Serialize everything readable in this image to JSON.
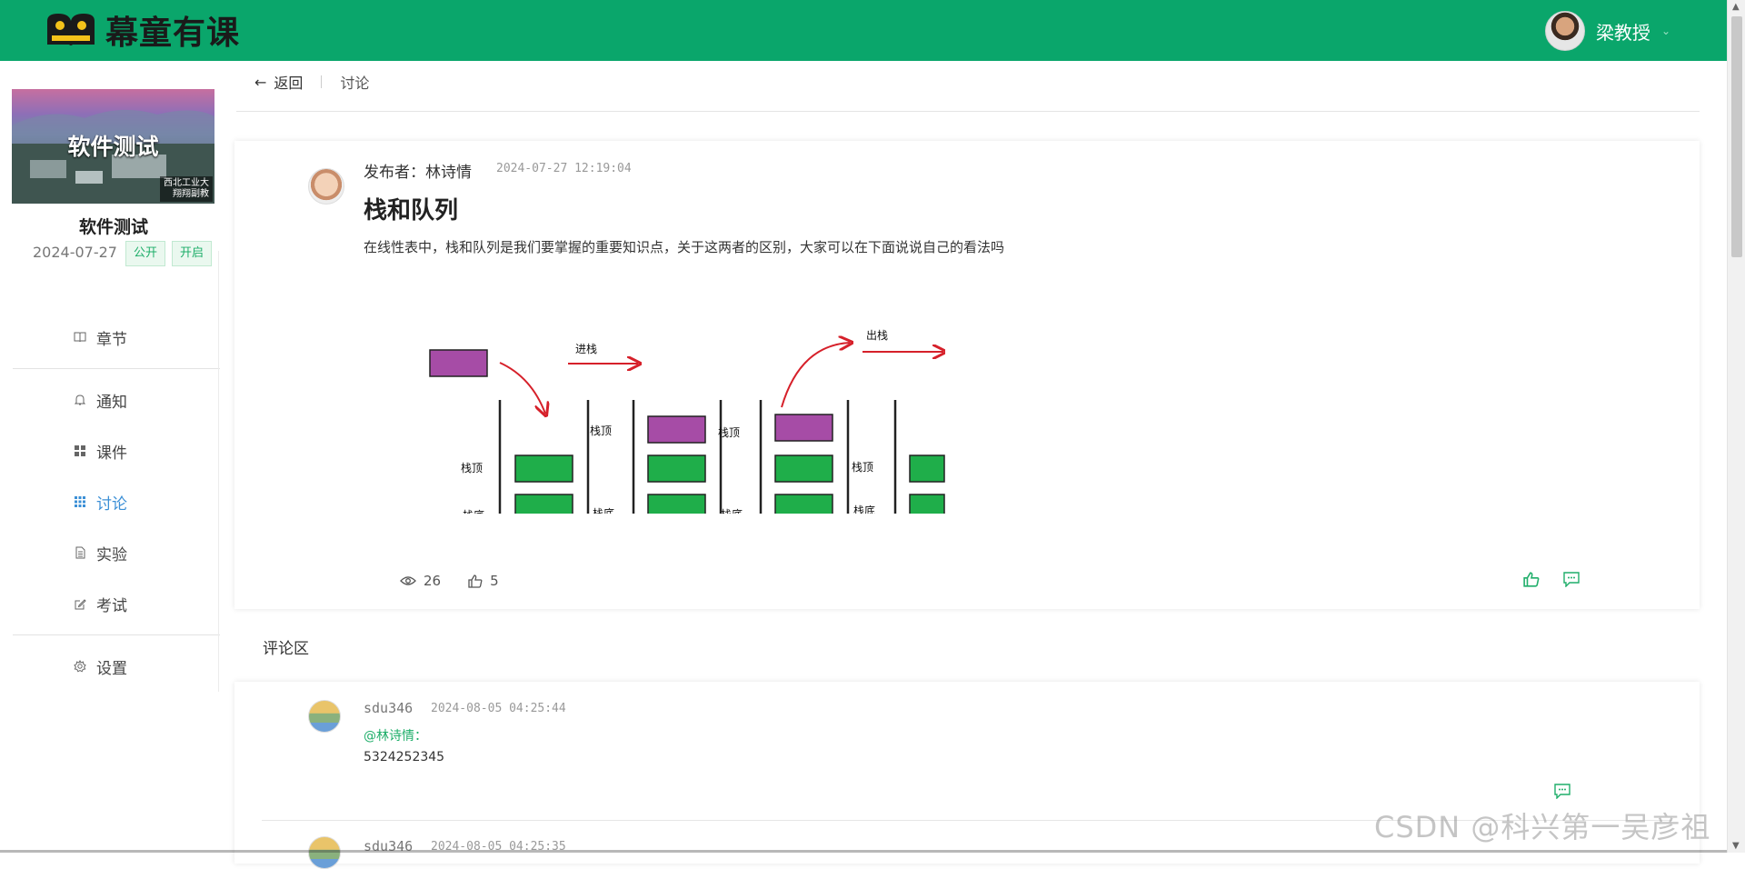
{
  "app": {
    "logo_text": "幕童有课"
  },
  "user": {
    "name": "梁教授"
  },
  "course": {
    "cover_title": "软件测试",
    "cover_badge_line1": "西北工业大",
    "cover_badge_line2": "翔翔副教",
    "name": "软件测试",
    "date": "2024-07-27",
    "tag_public": "公开",
    "tag_open": "开启"
  },
  "sidebar": {
    "items": [
      {
        "label": "章节",
        "icon": "book-icon"
      },
      {
        "label": "通知",
        "icon": "bell-icon"
      },
      {
        "label": "课件",
        "icon": "grid-icon"
      },
      {
        "label": "讨论",
        "icon": "table-icon",
        "active": true
      },
      {
        "label": "实验",
        "icon": "document-icon"
      },
      {
        "label": "考试",
        "icon": "edit-icon"
      },
      {
        "label": "设置",
        "icon": "gear-icon"
      }
    ]
  },
  "breadcrumb": {
    "back": "返回",
    "current": "讨论"
  },
  "post": {
    "author": "发布者：林诗情",
    "time": "2024-07-27 12:19:04",
    "title": "栈和队列",
    "body": "在线性表中，栈和队列是我们要掌握的重要知识点，关于这两者的区别，大家可以在下面说说自己的看法吗",
    "views": "26",
    "likes": "5",
    "figure": {
      "label_push": "进栈",
      "label_pop": "出栈",
      "label_top": "栈顶",
      "label_bottom": "栈底",
      "color_box_purple": "#a64ca6",
      "color_box_green": "#1fae4a",
      "color_arrow": "#d6202a"
    }
  },
  "comments": {
    "title": "评论区",
    "items": [
      {
        "user": "sdu346",
        "time": "2024-08-05 04:25:44",
        "mention": "@林诗情：",
        "text": "5324252345"
      },
      {
        "user": "sdu346",
        "time": "2024-08-05 04:25:35"
      }
    ]
  },
  "watermark": "CSDN @科兴第一吴彦祖",
  "colors": {
    "brand": "#0aa66b",
    "accent": "#1fae6a",
    "active": "#3b8fd6"
  }
}
